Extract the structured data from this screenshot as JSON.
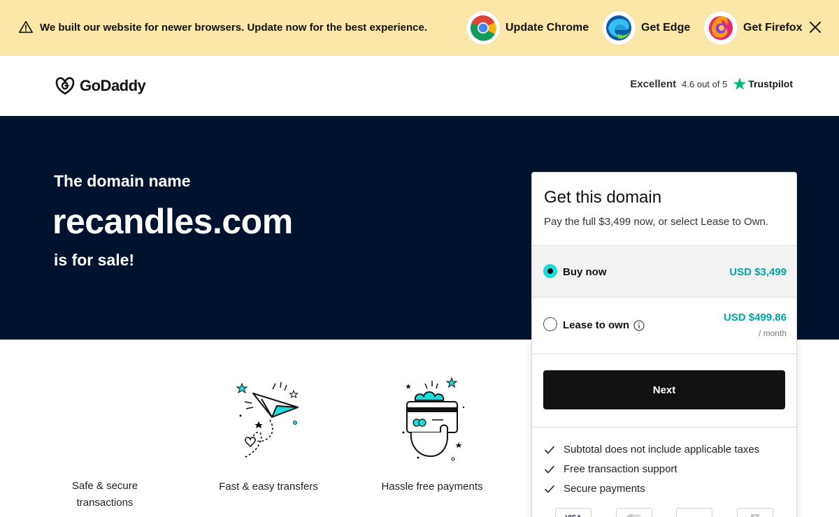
{
  "banner": {
    "message": "We built our website for newer browsers. Update now for the best experience.",
    "links": [
      {
        "label": "Update Chrome",
        "icon": "chrome-icon"
      },
      {
        "label": "Get Edge",
        "icon": "edge-icon"
      },
      {
        "label": "Get Firefox",
        "icon": "firefox-icon"
      }
    ],
    "close_icon": "close-icon",
    "bg_color": "#fbe7a7"
  },
  "header": {
    "logo_text": "GoDaddy",
    "trust": {
      "label": "Excellent",
      "rating": "4.6 out of 5",
      "provider": "Trustpilot",
      "star_color": "#00b67a"
    }
  },
  "hero": {
    "kicker": "The domain name",
    "domain": "recandles.com",
    "suffix": "is for sale!",
    "bg_color": "#00132e"
  },
  "features": [
    {
      "label": "Safe & secure transactions",
      "icon": "shield-icon"
    },
    {
      "label": "Fast & easy transfers",
      "icon": "paper-plane-icon"
    },
    {
      "label": "Hassle free payments",
      "icon": "card-payment-icon"
    }
  ],
  "card": {
    "title": "Get this domain",
    "subtitle": "Pay the full $3,499 now, or select Lease to Own.",
    "options": [
      {
        "label": "Buy now",
        "price": "USD $3,499",
        "selected": true
      },
      {
        "label": "Lease to own",
        "price": "USD $499.86",
        "per": "/ month",
        "selected": false
      }
    ],
    "next_label": "Next",
    "bullets": [
      "Subtotal does not include applicable taxes",
      "Free transaction support",
      "Secure payments"
    ],
    "payment_icons": [
      "VISA",
      "mastercard-icon",
      "amex-icon",
      "bank-icon"
    ],
    "accent_color": "#00a4a6"
  }
}
